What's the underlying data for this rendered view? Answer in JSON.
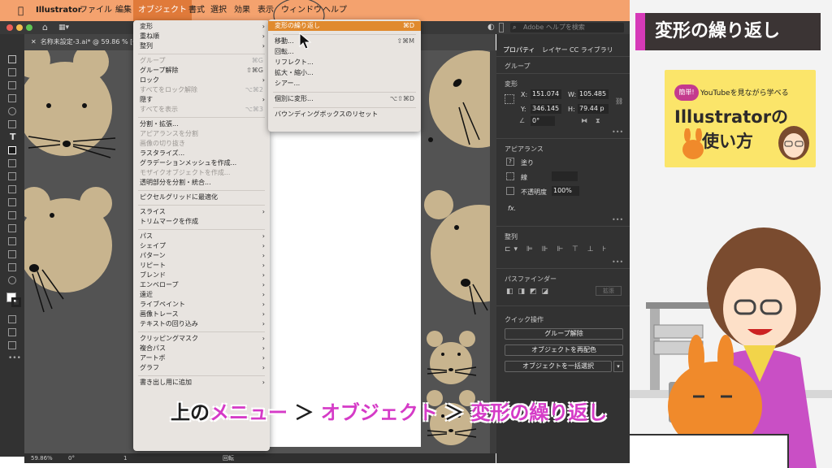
{
  "colors": {
    "menubar": "#f4a26e",
    "highlight": "#e08a2e",
    "caption_pink": "#d53bc7",
    "mouse_body": "#c8b48e",
    "banner_bg": "#3b3434"
  },
  "menubar": {
    "app": "Illustrator",
    "items": [
      "ファイル",
      "編集",
      "オブジェクト",
      "書式",
      "選択",
      "効果",
      "表示",
      "ウィンドウ",
      "ヘルプ"
    ],
    "search_placeholder": "Adobe ヘルプを検索"
  },
  "document": {
    "tab_label": "名称未設定-3.ai* @ 59.86 % [CMYK/GPU プレビュー]"
  },
  "object_menu": [
    {
      "label": "変形",
      "submenu": true
    },
    {
      "label": "重ね順",
      "submenu": true
    },
    {
      "label": "整列",
      "submenu": true
    },
    {
      "divider": true
    },
    {
      "label": "グループ",
      "shortcut": "⌘G",
      "disabled": true
    },
    {
      "label": "グループ解除",
      "shortcut": "⇧⌘G"
    },
    {
      "label": "ロック",
      "submenu": true
    },
    {
      "label": "すべてをロック解除",
      "shortcut": "⌥⌘2",
      "disabled": true
    },
    {
      "label": "隠す",
      "submenu": true
    },
    {
      "label": "すべてを表示",
      "shortcut": "⌥⌘3",
      "disabled": true
    },
    {
      "divider": true
    },
    {
      "label": "分割・拡張..."
    },
    {
      "label": "アピアランスを分割",
      "disabled": true
    },
    {
      "label": "画像の切り抜き",
      "disabled": true
    },
    {
      "label": "ラスタライズ..."
    },
    {
      "label": "グラデーションメッシュを作成..."
    },
    {
      "label": "モザイクオブジェクトを作成...",
      "disabled": true
    },
    {
      "label": "透明部分を分割・統合..."
    },
    {
      "divider": true
    },
    {
      "label": "ピクセルグリッドに最適化"
    },
    {
      "divider": true
    },
    {
      "label": "スライス",
      "submenu": true
    },
    {
      "label": "トリムマークを作成"
    },
    {
      "divider": true
    },
    {
      "label": "パス",
      "submenu": true
    },
    {
      "label": "シェイプ",
      "submenu": true
    },
    {
      "label": "パターン",
      "submenu": true
    },
    {
      "label": "リピート",
      "submenu": true
    },
    {
      "label": "ブレンド",
      "submenu": true
    },
    {
      "label": "エンベロープ",
      "submenu": true
    },
    {
      "label": "遠近",
      "submenu": true
    },
    {
      "label": "ライブペイント",
      "submenu": true
    },
    {
      "label": "画像トレース",
      "submenu": true
    },
    {
      "label": "テキストの回り込み",
      "submenu": true
    },
    {
      "divider": true
    },
    {
      "label": "クリッピングマスク",
      "submenu": true
    },
    {
      "label": "複合パス",
      "submenu": true
    },
    {
      "label": "アートボ",
      "submenu": true
    },
    {
      "label": "グラフ",
      "submenu": true
    },
    {
      "divider": true
    },
    {
      "label": "書き出し用に追加",
      "submenu": true
    }
  ],
  "transform_submenu": [
    {
      "label": "変形の繰り返し",
      "shortcut": "⌘D",
      "highlighted": true
    },
    {
      "divider": true
    },
    {
      "label": "移動...",
      "shortcut": "⇧⌘M"
    },
    {
      "label": "回転..."
    },
    {
      "label": "リフレクト..."
    },
    {
      "label": "拡大・縮小..."
    },
    {
      "label": "シアー..."
    },
    {
      "divider": true
    },
    {
      "label": "個別に変形...",
      "shortcut": "⌥⇧⌘D"
    },
    {
      "divider": true
    },
    {
      "label": "バウンディングボックスのリセット"
    }
  ],
  "panel": {
    "tabs": [
      "プロパティ",
      "レイヤー",
      "CC ライブラリ"
    ],
    "group_label": "グループ",
    "transform_title": "変形",
    "x_label": "X:",
    "x_value": "151.074",
    "y_label": "Y:",
    "y_value": "346.145",
    "w_label": "W:",
    "w_value": "105.485",
    "h_label": "H:",
    "h_value": "79.44 p",
    "angle_value": "0°",
    "appearance_title": "アピアランス",
    "fill_label": "塗り",
    "stroke_label": "線",
    "opacity_label": "不透明度",
    "opacity_value": "100%",
    "fx_label": "fx.",
    "align_title": "整列",
    "pathfinder_title": "パスファインダー",
    "expand_label": "拡張",
    "quick_title": "クイック操作",
    "quick_buttons": [
      "グループ解除",
      "オブジェクトを再配色",
      "オブジェクトを一括選択"
    ]
  },
  "status": {
    "zoom": "59.86%",
    "angle": "0°",
    "artboard": "1",
    "tool": "回転"
  },
  "tutorial": {
    "title": "変形の繰り返し",
    "book_badge": "簡単!",
    "book_sub": "YouTubeを見ながら学べる",
    "book_line1": "Illustratorの",
    "book_line2": "使い方"
  },
  "caption": {
    "part1": "上の",
    "part2": "メニュー",
    "sep1": " ＞ ",
    "part3": "オブジェクト",
    "sep2": " ＞ ",
    "part4": "変形の繰り返し"
  }
}
